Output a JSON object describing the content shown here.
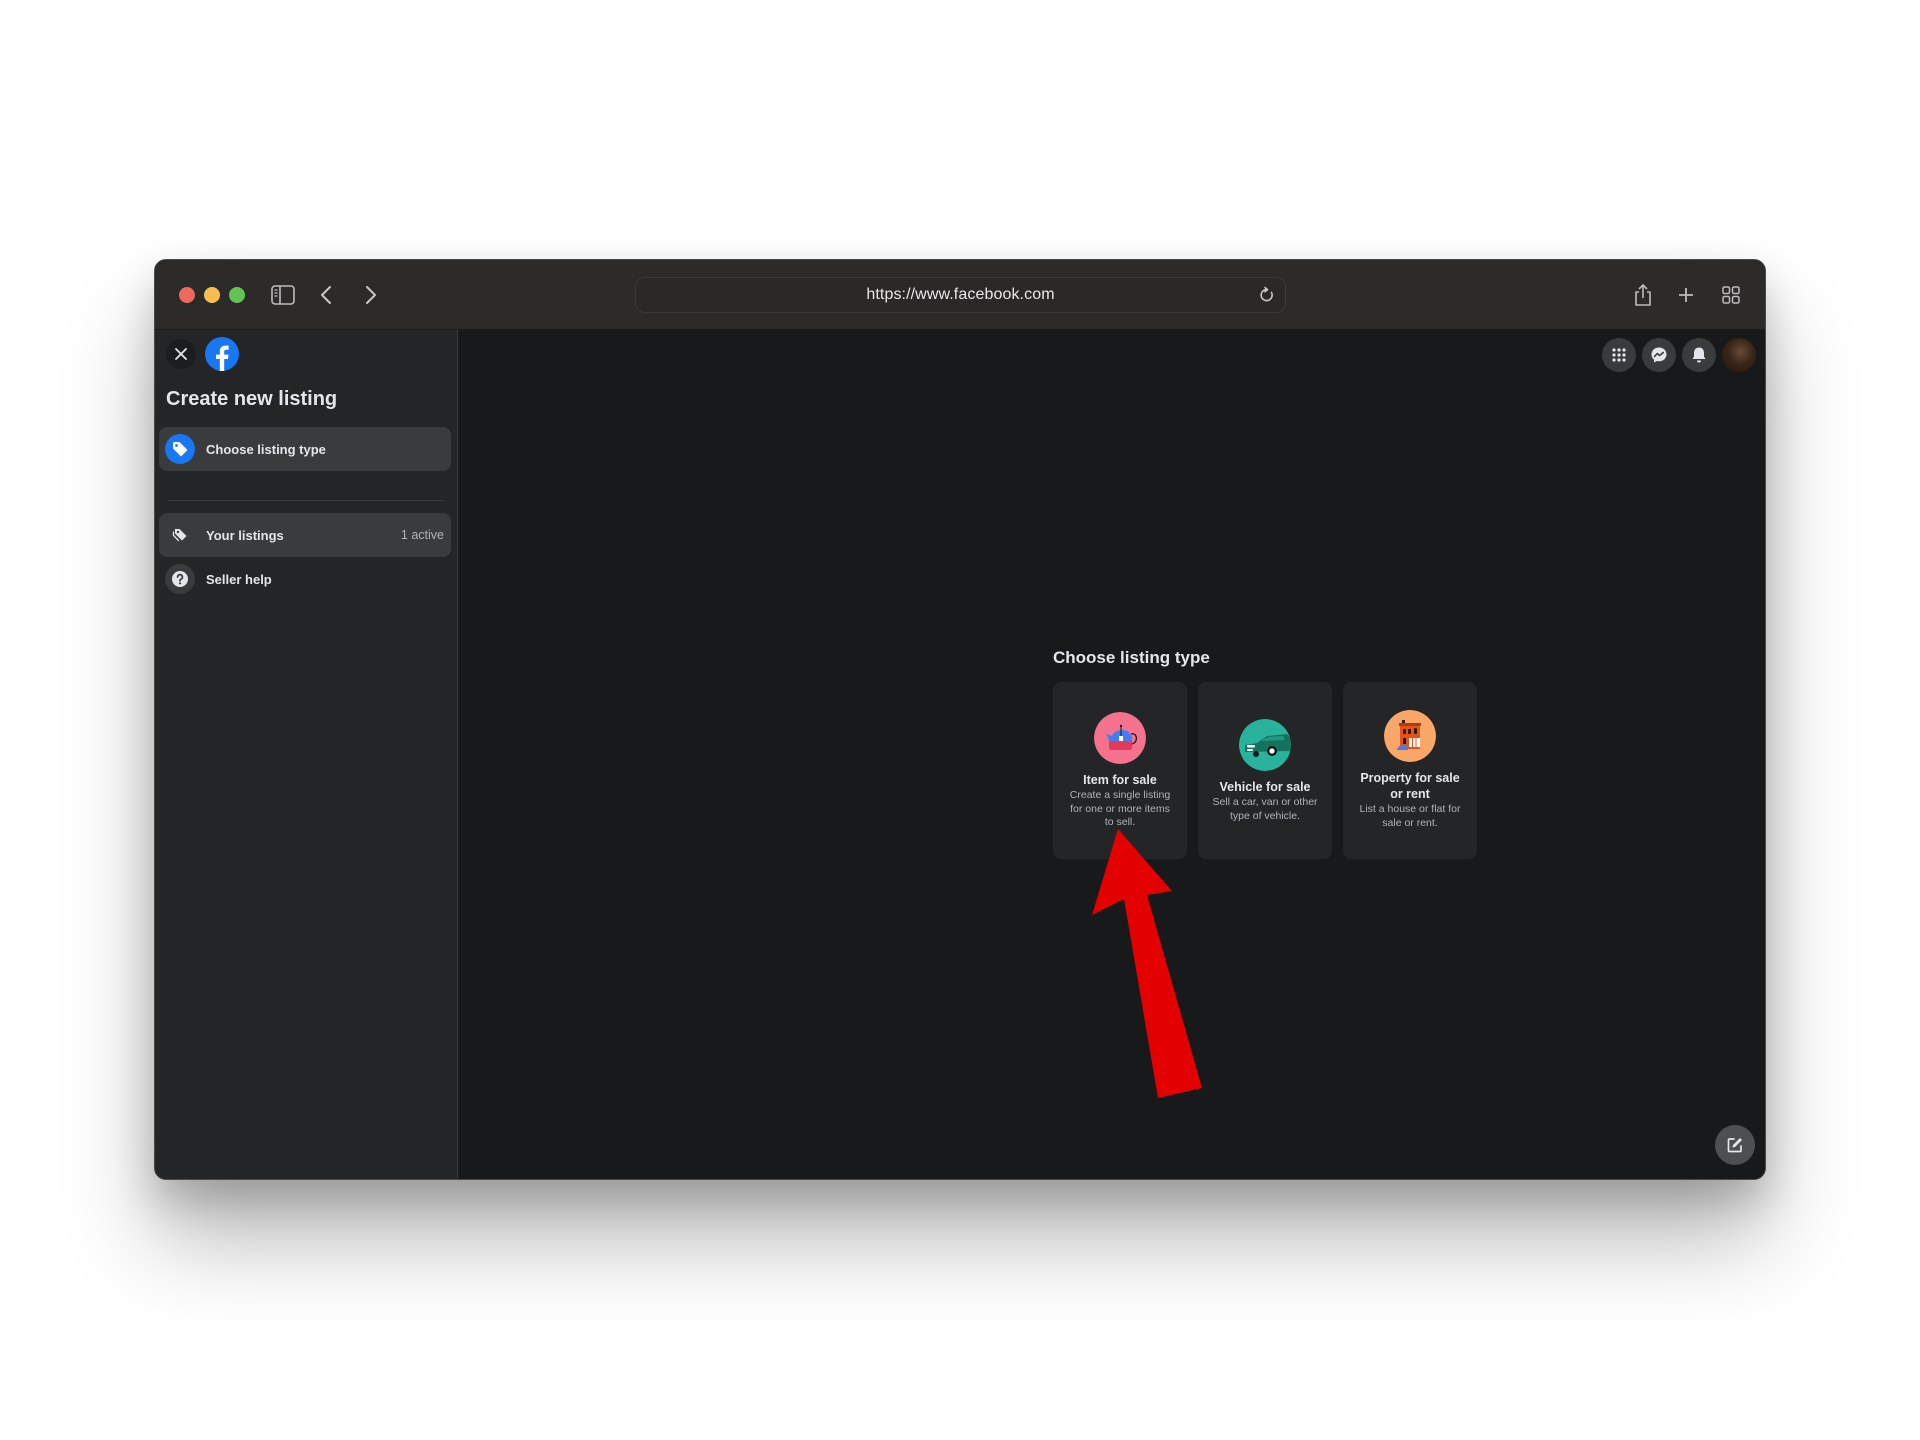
{
  "browser": {
    "url": "https://www.facebook.com",
    "icons": [
      "sidebar-toggle-icon",
      "back-icon",
      "forward-icon",
      "reload-icon",
      "share-icon",
      "new-tab-icon",
      "tab-overview-icon"
    ]
  },
  "sidebar": {
    "title": "Create new listing",
    "items": [
      {
        "label": "Choose listing type",
        "icon": "tag-icon",
        "active": true
      },
      {
        "label": "Your listings",
        "meta": "1 active",
        "icon": "tags-icon"
      },
      {
        "label": "Seller help",
        "icon": "help-icon"
      }
    ]
  },
  "header_icons": [
    "menu-grid-icon",
    "messenger-icon",
    "notifications-icon",
    "profile-avatar"
  ],
  "main": {
    "section_title": "Choose listing type",
    "cards": [
      {
        "title": "Item for sale",
        "description": "Create a single listing for one or more items to sell.",
        "icon": "teapot-icon",
        "color": "#f5728e"
      },
      {
        "title": "Vehicle for sale",
        "description": "Sell a car, van or other type of vehicle.",
        "icon": "car-icon",
        "color": "#2ab39c"
      },
      {
        "title": "Property for sale or rent",
        "description": "List a house or flat for sale or rent.",
        "icon": "house-icon",
        "color": "#fba76a"
      }
    ]
  },
  "colors": {
    "accent": "#1877f2",
    "annotation_arrow": "#e30000"
  }
}
